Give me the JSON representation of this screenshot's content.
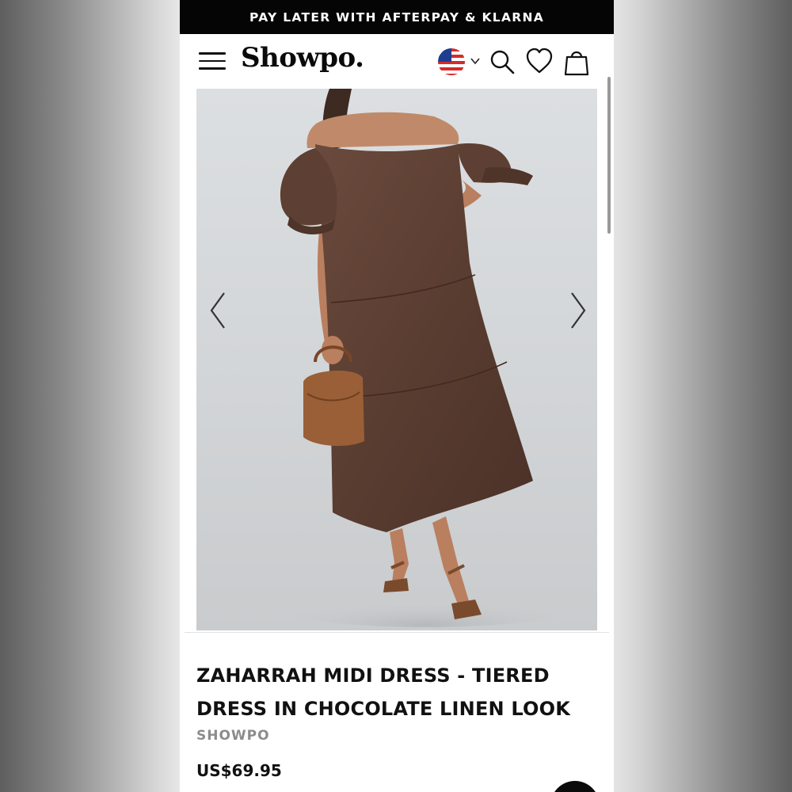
{
  "promo": {
    "text": "PAY LATER WITH AFTERPAY & KLARNA"
  },
  "header": {
    "menu_icon": "hamburger-menu-icon",
    "logo": "Showpo.",
    "region_flag": "us-flag-icon",
    "region_dropdown_icon": "chevron-down-icon",
    "search_icon": "search-icon",
    "wishlist_icon": "heart-icon",
    "bag_icon": "shopping-bag-icon"
  },
  "gallery": {
    "prev_icon": "chevron-left-icon",
    "next_icon": "chevron-right-icon",
    "image_subject": "model wearing brown tiered off-shoulder midi dress holding tan handbag"
  },
  "product": {
    "title": "ZAHARRAH MIDI DRESS - TIERED DRESS IN CHOCOLATE LINEN LOOK",
    "brand": "SHOWPO",
    "price": "US$69.95"
  },
  "colors": {
    "promo_bg": "#050505",
    "text_primary": "#111111",
    "brand_grey": "#8c8c8c",
    "dress_brown": "#5a3d31",
    "bag_tan": "#9a5f36"
  }
}
